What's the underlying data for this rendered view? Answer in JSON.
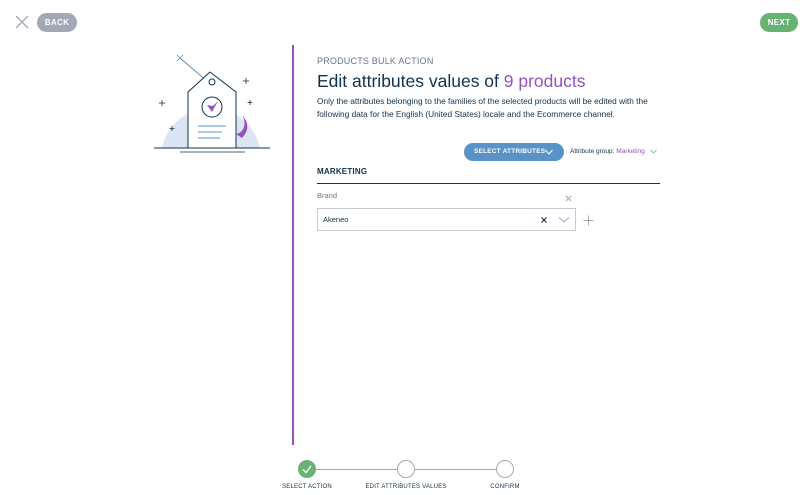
{
  "header": {
    "back_label": "BACK",
    "next_label": "NEXT",
    "close_icon": "close-icon"
  },
  "action": {
    "subtitle": "PRODUCTS BULK ACTION",
    "title_prefix": "Edit attributes values of ",
    "title_count": "9 products",
    "description": "Only the attributes belonging to the families of the selected products will be edited with the following data for the English (United States) locale and the Ecommerce channel."
  },
  "toolbar": {
    "select_attributes_label": "SELECT ATTRIBUTES",
    "attribute_group_label": "Attribute group: ",
    "attribute_group_value": "Marketing"
  },
  "section": {
    "title": "MARKETING",
    "fields": [
      {
        "label": "Brand",
        "value": "Akeneo"
      }
    ]
  },
  "steps": [
    {
      "label": "SELECT ACTION",
      "status": "done"
    },
    {
      "label": "EDIT ATTRIBUTES VALUES",
      "status": "current"
    },
    {
      "label": "CONFIRM",
      "status": "todo"
    }
  ],
  "colors": {
    "purple": "#9452ba",
    "green": "#67b373",
    "blue": "#5992c7",
    "grey": "#a1a9b7",
    "text": "#11324d"
  }
}
